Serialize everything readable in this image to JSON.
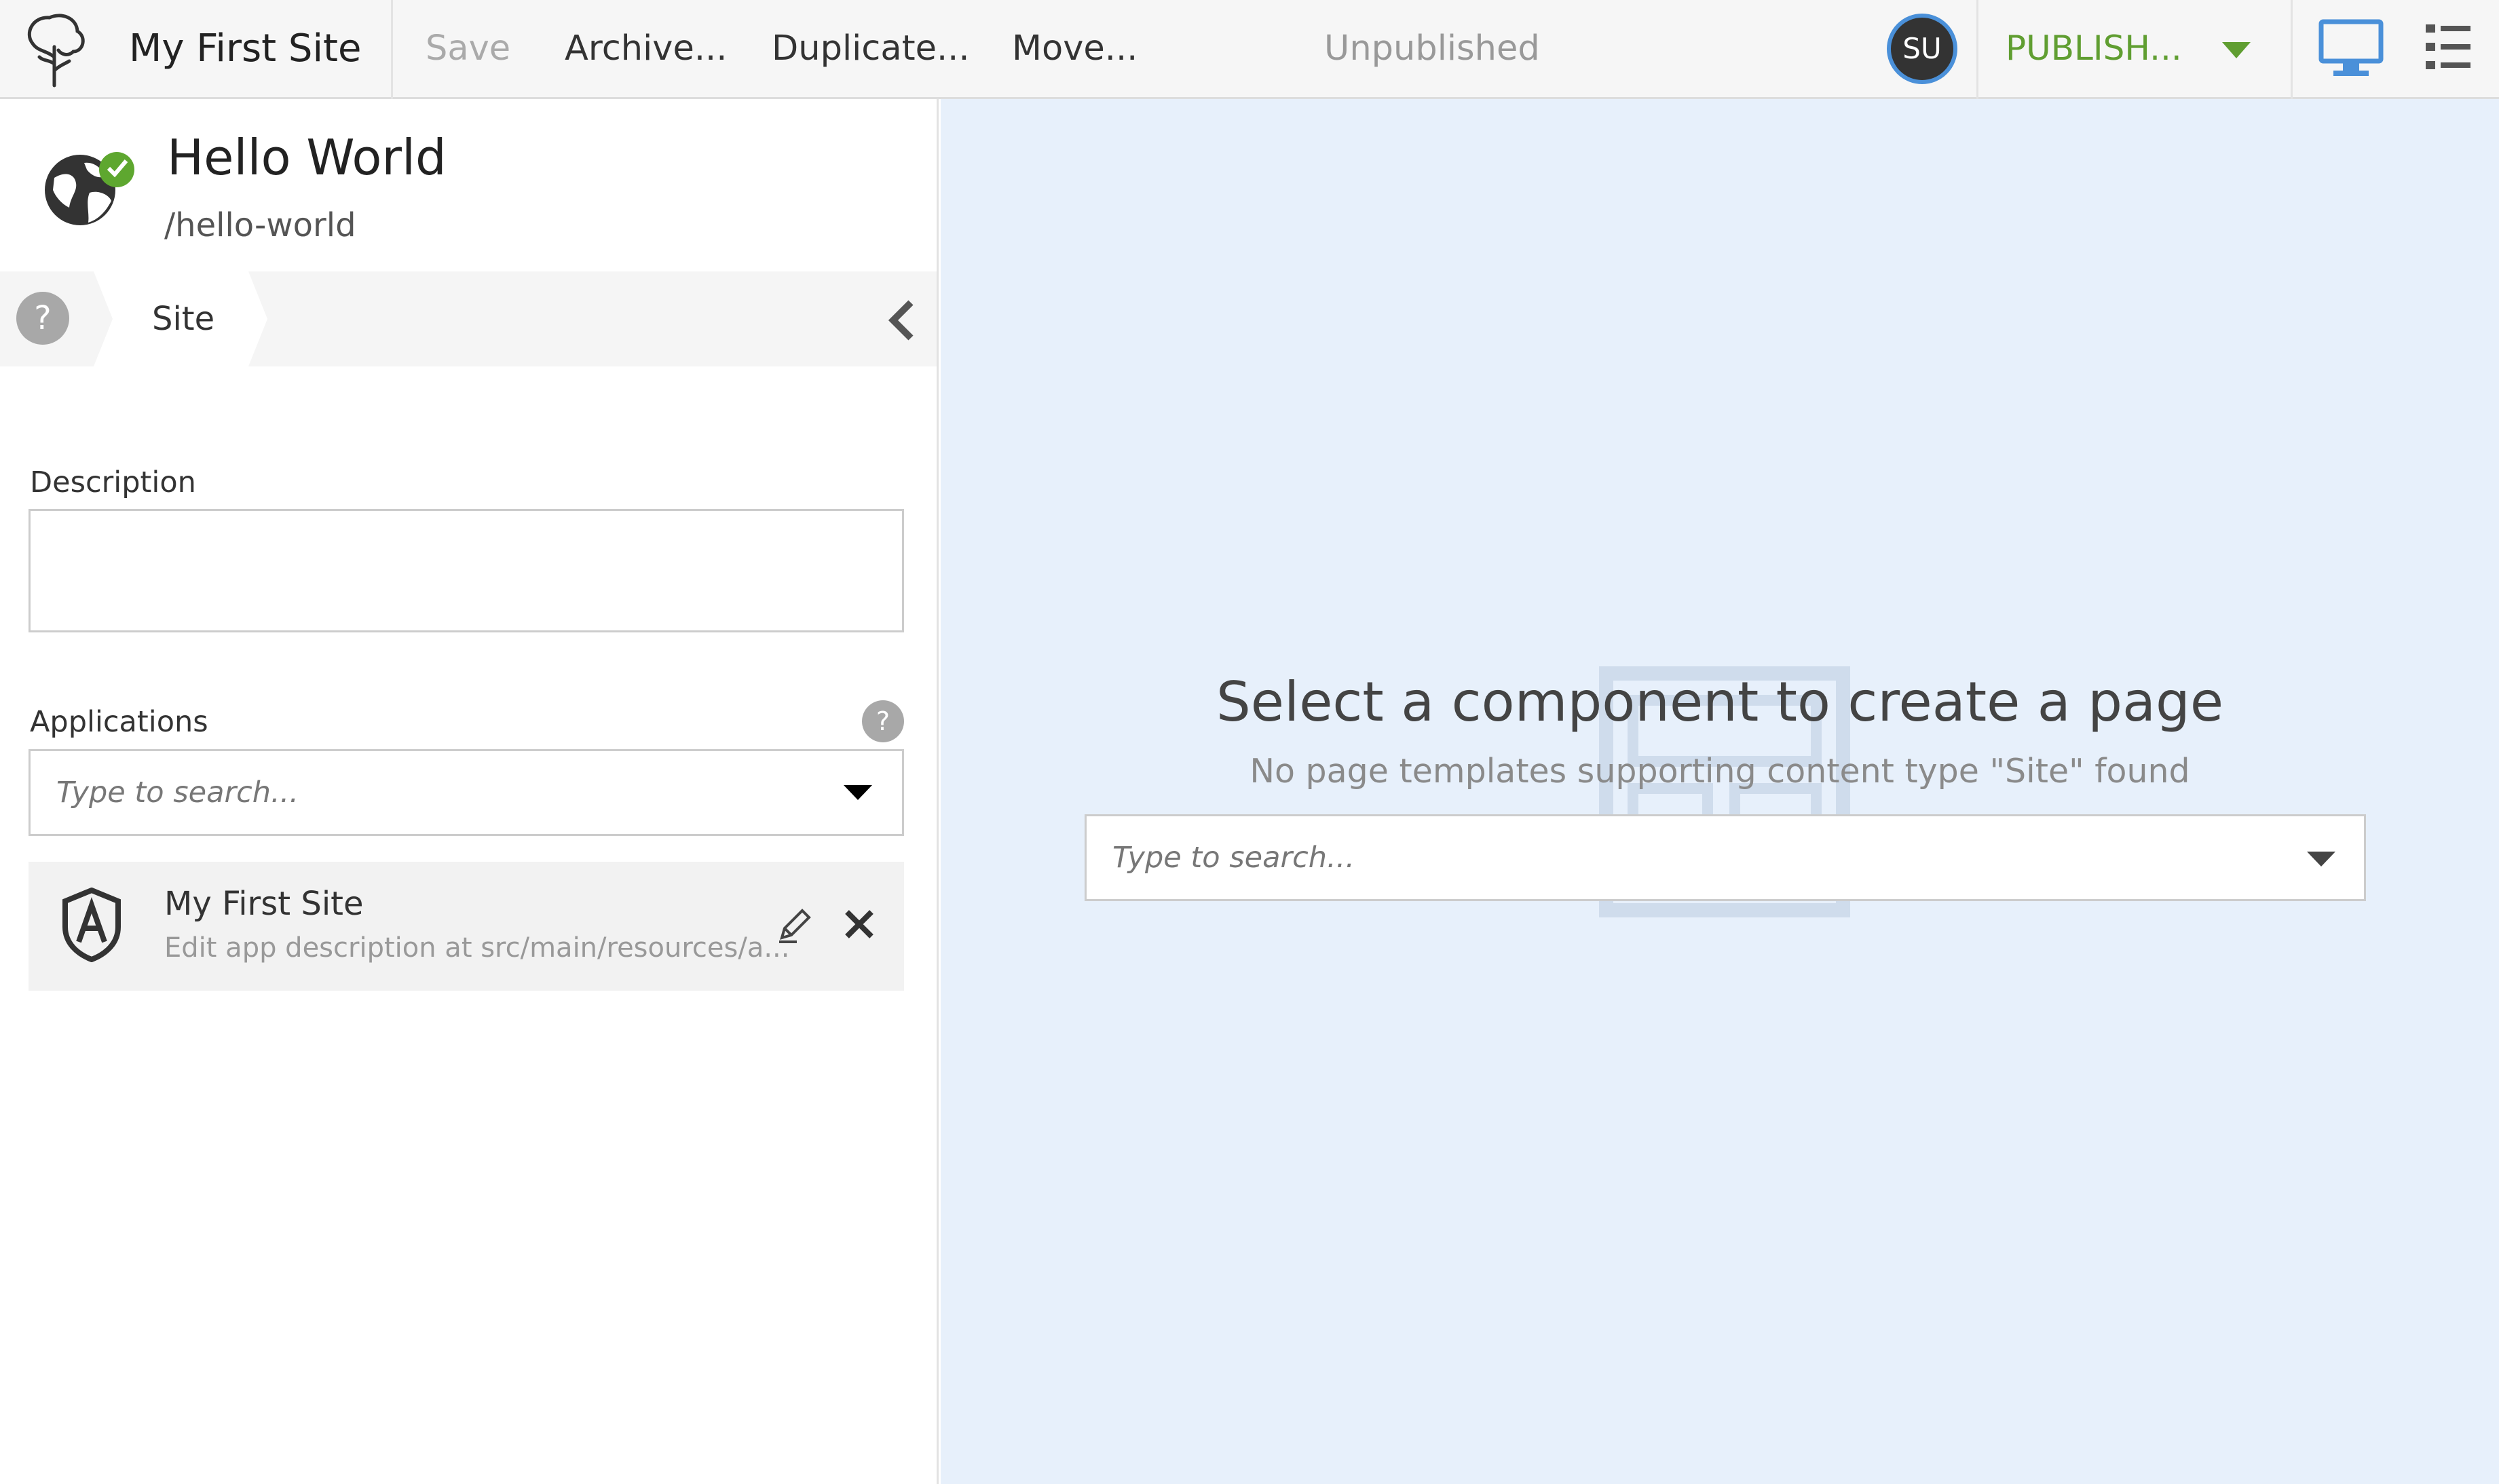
{
  "toolbar": {
    "site_name": "My First Site",
    "actions": [
      {
        "label": "Save",
        "enabled": false
      },
      {
        "label": "Archive...",
        "enabled": true
      },
      {
        "label": "Duplicate...",
        "enabled": true
      },
      {
        "label": "Move...",
        "enabled": true
      }
    ],
    "status": "Unpublished",
    "user_initials": "SU",
    "publish_label": "PUBLISH...",
    "colors": {
      "publish": "#609e31",
      "accent": "#4a90d9",
      "avatar": "#333333"
    }
  },
  "content": {
    "title": "Hello World",
    "path": "/hello-world",
    "status_icon": "check-icon"
  },
  "step_nav": {
    "help_label": "?",
    "current_step": "Site"
  },
  "form": {
    "description_label": "Description",
    "description_value": "",
    "applications_label": "Applications",
    "applications_help": "?",
    "applications_placeholder": "Type to search...",
    "selected_app": {
      "name": "My First Site",
      "description": "Edit app description at src/main/resources/a..."
    }
  },
  "live_view": {
    "heading": "Select a component to create a page",
    "subheading": "No page templates supporting content type \"Site\" found",
    "search_placeholder": "Type to search..."
  }
}
